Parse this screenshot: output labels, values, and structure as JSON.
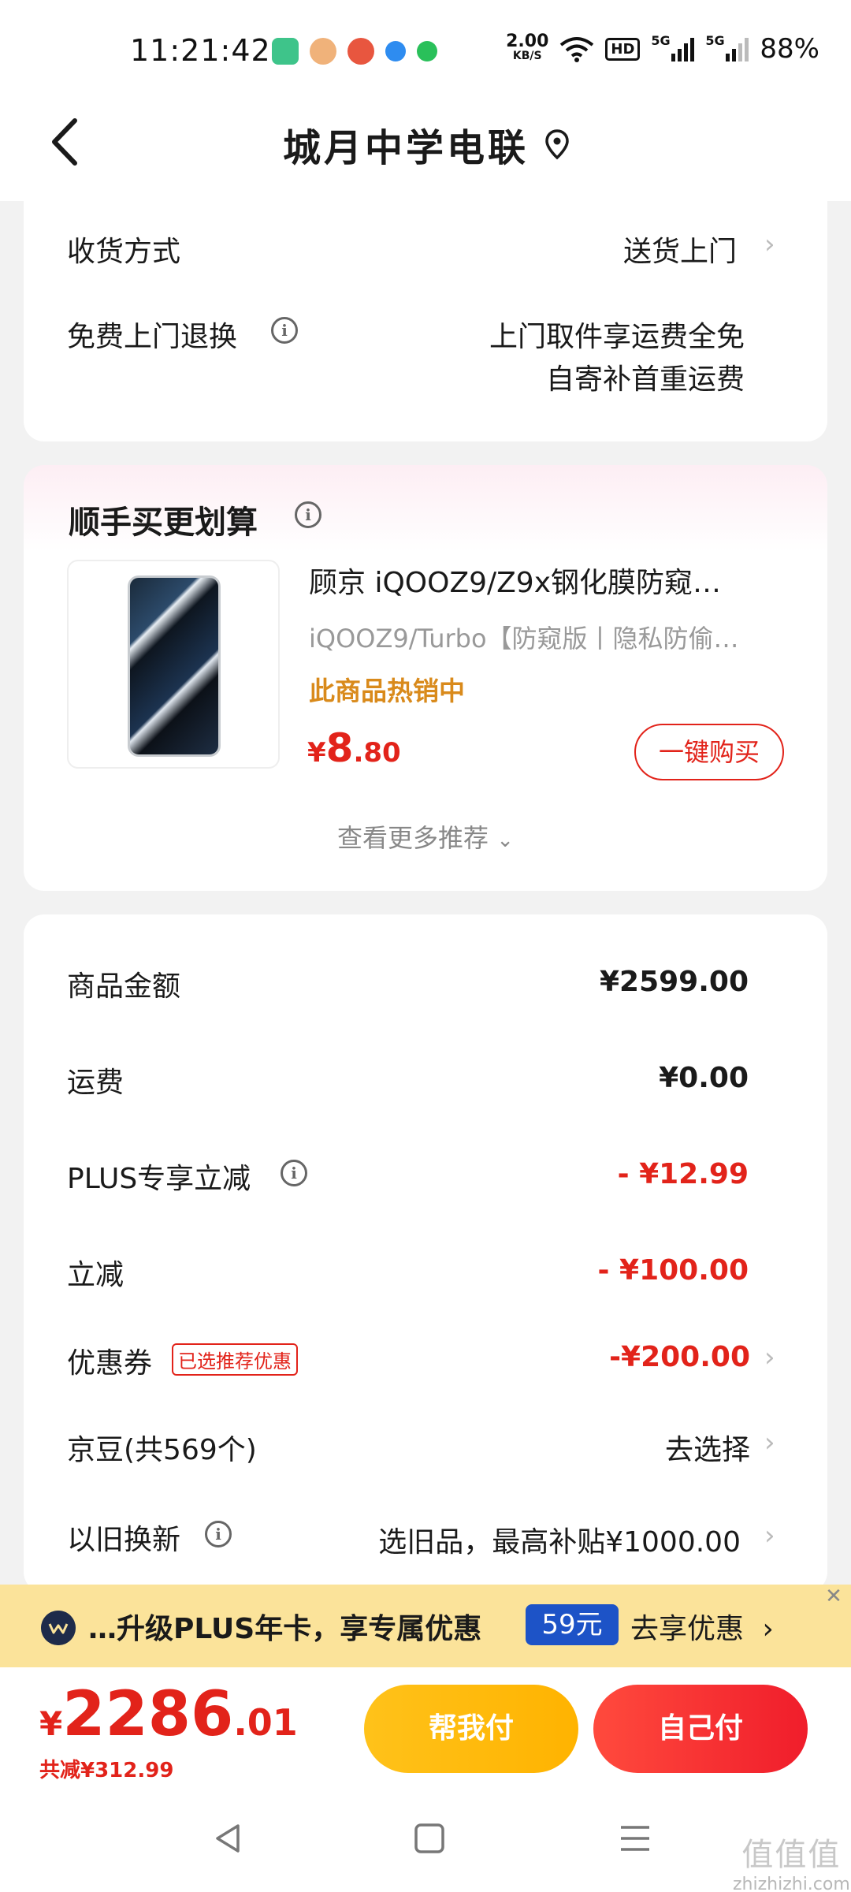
{
  "status_bar": {
    "time": "11:21:42",
    "net_speed_value": "2.00",
    "net_speed_unit": "KB/S",
    "hd_label": "HD",
    "sim1_label": "5G",
    "sim2_label": "5G",
    "battery": "88%"
  },
  "nav": {
    "title": "城月中学电联"
  },
  "delivery": {
    "method_label": "收货方式",
    "method_value": "送货上门",
    "return_label": "免费上门退换",
    "return_value_line1": "上门取件享运费全免",
    "return_value_line2": "自寄补首重运费"
  },
  "recommend": {
    "title": "顺手买更划算",
    "product_title": "顾京  iQOOZ9/Z9x钢化膜防窥…",
    "product_sub": "iQOOZ9/Turbo【防窥版丨隐私防偷…",
    "hot_text": "此商品热销中",
    "price_currency": "¥",
    "price_int": "8",
    "price_dec": ".80",
    "buy_label": "一键购买",
    "more_label": "查看更多推荐"
  },
  "summary": {
    "rows": [
      {
        "label": "商品金额",
        "value": "¥2599.00"
      },
      {
        "label": "运费",
        "value": "¥0.00"
      },
      {
        "label": "PLUS专享立减",
        "value": "- ¥12.99"
      },
      {
        "label": "立减",
        "value": "- ¥100.00"
      },
      {
        "label": "优惠券",
        "tag": "已选推荐优惠",
        "value": "-¥200.00"
      },
      {
        "label": "京豆(共569个)",
        "value": "去选择"
      },
      {
        "label": "以旧换新",
        "value": "选旧品，最高补贴¥1000.00"
      }
    ]
  },
  "promo": {
    "text": "…升级PLUS年卡，享专属优惠",
    "badge": "59元",
    "cta": "去享优惠"
  },
  "checkout": {
    "currency": "¥",
    "total_int": "2286",
    "total_dec": ".01",
    "saved": "共减¥312.99",
    "help_pay": "帮我付",
    "self_pay": "自己付"
  },
  "watermark": {
    "big": "值值值",
    "small": "zhizhizhi.com"
  },
  "colors": {
    "accent_red": "#e2231a",
    "promo_yellow": "#fbe39a",
    "plus_blue": "#1d53c7",
    "hot_orange": "#d98a1b"
  }
}
